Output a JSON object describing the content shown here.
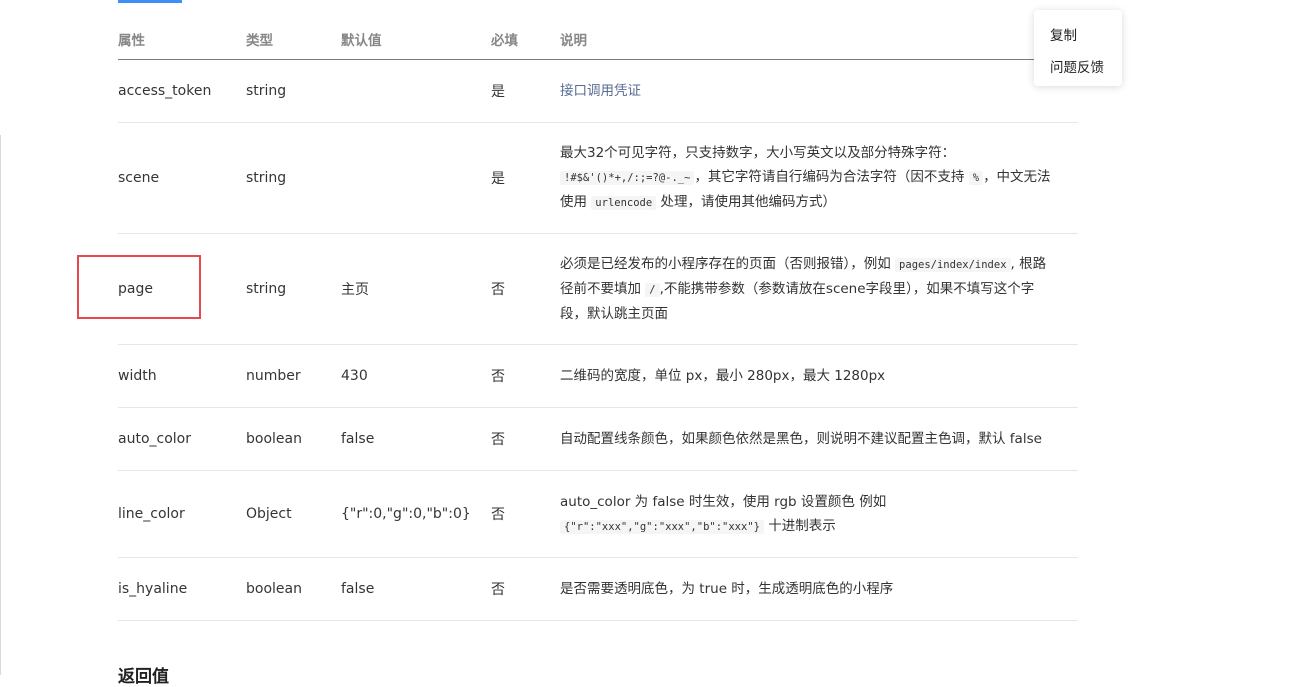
{
  "table": {
    "headers": [
      "属性",
      "类型",
      "默认值",
      "必填",
      "说明"
    ],
    "rows": [
      {
        "name": "access_token",
        "type": "string",
        "default": "",
        "required": "是",
        "desc": [
          "接口调用凭证"
        ]
      },
      {
        "name": "scene",
        "type": "string",
        "default": "",
        "required": "是",
        "desc": [
          "最大32个可见字符，只支持数字，大小写英文以及部分特殊字符：",
          "!#$&'()*+,/:;=?@-._~",
          "，其它字符请自行编码为合法字符（因不支持",
          "%",
          "，中文无法",
          "使用",
          "urlencode",
          "处理，请使用其他编码方式）"
        ]
      },
      {
        "name": "page",
        "type": "string",
        "default": "主页",
        "required": "否",
        "desc": [
          "必须是已经发布的小程序存在的页面（否则报错），例如",
          "pages/index/index",
          ", 根路",
          "径前不要填加",
          "/",
          ",不能携带参数（参数请放在scene字段里），如果不填写这个字",
          "段，默认跳主页面"
        ]
      },
      {
        "name": "width",
        "type": "number",
        "default": "430",
        "required": "否",
        "desc": [
          "二维码的宽度，单位 px，最小 280px，最大 1280px"
        ]
      },
      {
        "name": "auto_color",
        "type": "boolean",
        "default": "false",
        "required": "否",
        "desc": [
          "自动配置线条颜色，如果颜色依然是黑色，则说明不建议配置主色调，默认 false"
        ]
      },
      {
        "name": "line_color",
        "type": "Object",
        "default": "{\"r\":0,\"g\":0,\"b\":0}",
        "required": "否",
        "desc": [
          "auto_color 为 false 时生效，使用 rgb 设置颜色 例如",
          "{\"r\":\"xxx\",\"g\":\"xxx\",\"b\":\"xxx\"}",
          "十进制表示"
        ]
      },
      {
        "name": "is_hyaline",
        "type": "boolean",
        "default": "false",
        "required": "否",
        "desc": [
          "是否需要透明底色，为 true 时，生成透明底色的小程序"
        ]
      }
    ]
  },
  "context_menu": {
    "copy": "复制",
    "feedback": "问题反馈"
  },
  "next_section": "返回值",
  "colors": {
    "accent": "#3e8ef7",
    "highlight": "#e5484d",
    "link": "#576b95"
  }
}
